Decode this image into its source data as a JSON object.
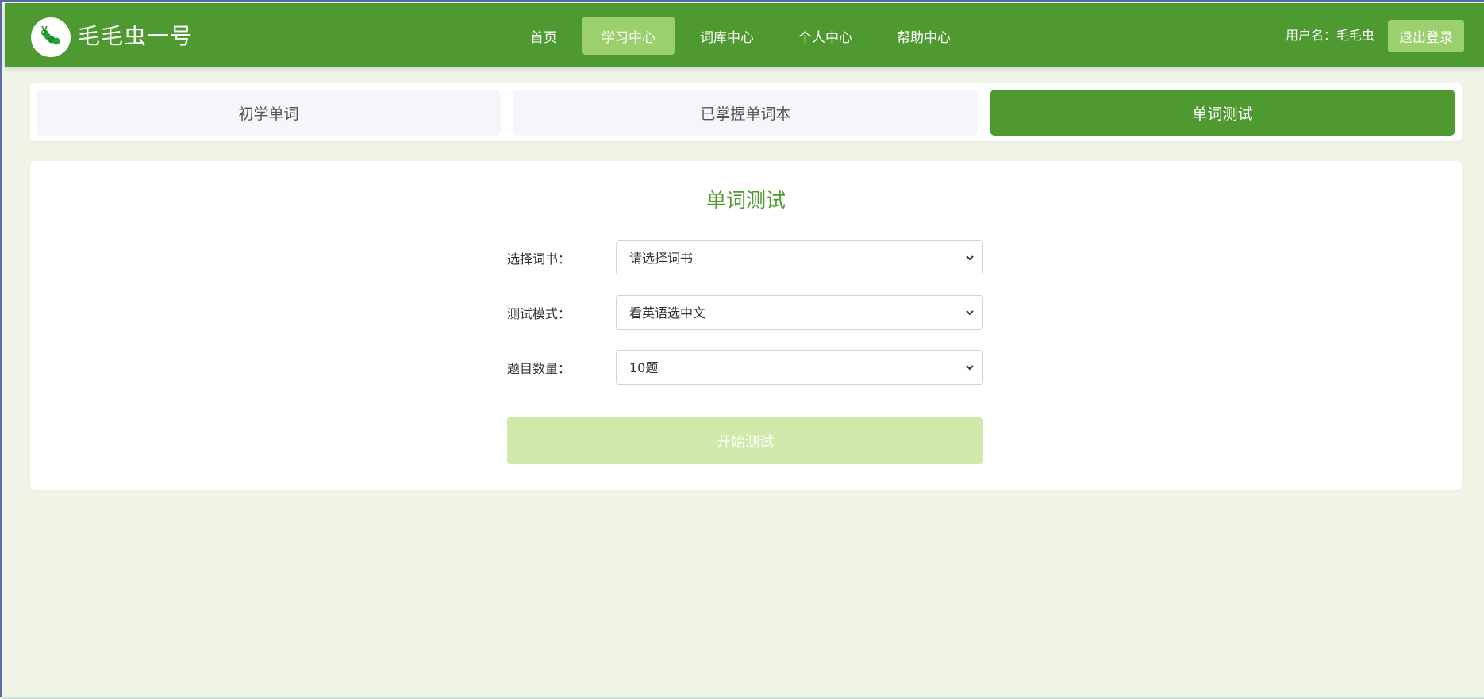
{
  "header": {
    "brand": "毛毛虫一号",
    "logo_icon": "caterpillar-icon",
    "nav": [
      {
        "label": "首页",
        "active": false
      },
      {
        "label": "学习中心",
        "active": true
      },
      {
        "label": "词库中心",
        "active": false
      },
      {
        "label": "个人中心",
        "active": false
      },
      {
        "label": "帮助中心",
        "active": false
      }
    ],
    "user_label": "用户名：毛毛虫",
    "logout_label": "退出登录"
  },
  "tabs": [
    {
      "label": "初学单词",
      "active": false
    },
    {
      "label": "已掌握单词本",
      "active": false
    },
    {
      "label": "单词测试",
      "active": true
    }
  ],
  "main": {
    "title": "单词测试",
    "fields": [
      {
        "label": "选择词书：",
        "value": "请选择词书"
      },
      {
        "label": "测试模式：",
        "value": "看英语选中文"
      },
      {
        "label": "题目数量：",
        "value": "10题"
      }
    ],
    "start_label": "开始测试"
  },
  "colors": {
    "primary": "#4f9a30",
    "accent_light": "#9ccf6e",
    "disabled_button": "#cfe9ab",
    "page_bg": "#f0f4e6"
  }
}
